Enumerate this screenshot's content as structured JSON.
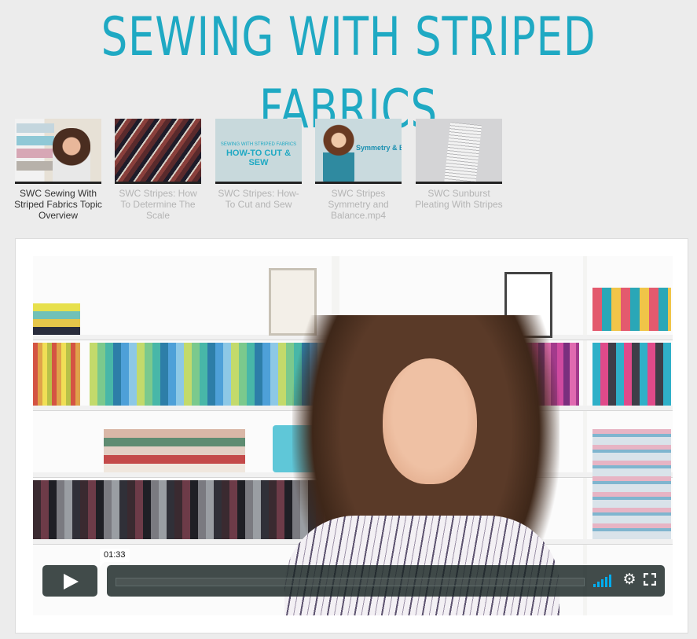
{
  "page": {
    "title": "SEWING WITH STRIPED FABRICS"
  },
  "playlist": {
    "items": [
      {
        "title": "SWC Sewing With Striped Fabrics Topic Overview",
        "active": true
      },
      {
        "title": "SWC Stripes: How To Determine The Scale",
        "active": false
      },
      {
        "title": "SWC Stripes: How-To Cut and Sew",
        "active": false,
        "thumb_small": "SEWING WITH STRIPED FABRICS",
        "thumb_big": "HOW-TO CUT & SEW"
      },
      {
        "title": "SWC Stripes Symmetry and Balance.mp4",
        "active": false,
        "thumb_label": "Symmetry & Bala"
      },
      {
        "title": "SWC Sunburst Pleating With Stripes",
        "active": false
      }
    ]
  },
  "player": {
    "timestamp": "01:33",
    "volume_level": 1.0,
    "colors": {
      "accent": "#00adef",
      "controls_bg": "#172322",
      "title": "#1fa9c3"
    }
  }
}
